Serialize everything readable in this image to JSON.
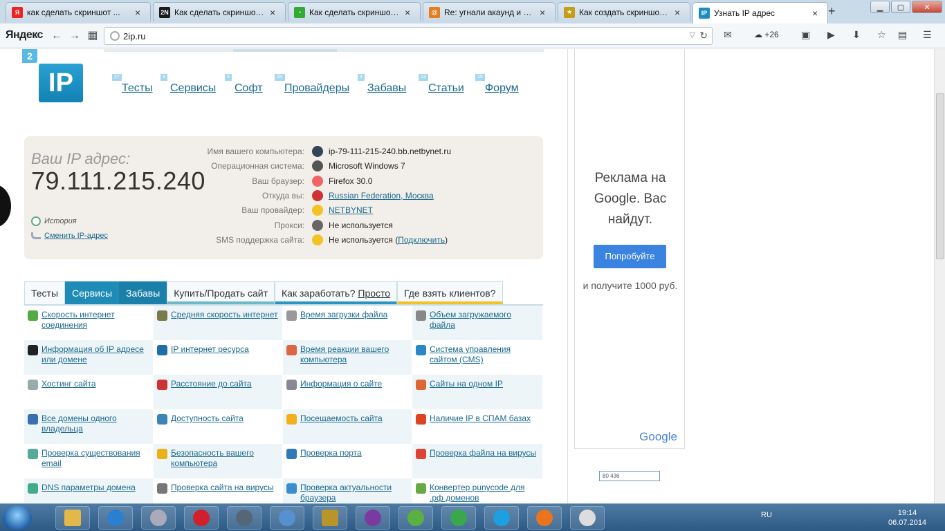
{
  "browser": {
    "tabs": [
      {
        "title": "как сделать скриншот ...",
        "favicon_color": "#e22",
        "favicon_text": "Я"
      },
      {
        "title": "Как сделать скриншот ...",
        "favicon_color": "#1a1a1a",
        "favicon_text": "2N"
      },
      {
        "title": "Как сделать скриншот ...",
        "favicon_color": "#3a3",
        "favicon_text": "◔"
      },
      {
        "title": "Re: угнали акаунд и по...",
        "favicon_color": "#e77c1c",
        "favicon_text": "@"
      },
      {
        "title": "Как создать скриншот ...",
        "favicon_color": "#c59d17",
        "favicon_text": "★"
      },
      {
        "title": "Узнать IP адрес",
        "favicon_color": "#1e8bc3",
        "favicon_text": "IP"
      }
    ],
    "new_tab": "+",
    "yandex_logo": "Яндекс",
    "url": "2ip.ru",
    "weather": "+26"
  },
  "site": {
    "logo_small": "2",
    "logo": "IP",
    "nav": [
      {
        "label": "Тесты",
        "badge": "27"
      },
      {
        "label": "Сервисы",
        "badge": "9"
      },
      {
        "label": "Софт",
        "badge": "5"
      },
      {
        "label": "Провайдеры",
        "badge": "2K"
      },
      {
        "label": "Забавы",
        "badge": "4"
      },
      {
        "label": "Статьи",
        "badge": "13"
      },
      {
        "label": "Форум",
        "badge": "15"
      }
    ],
    "ip_label": "Ваш IP адрес:",
    "ip_value": "79.111.215.240",
    "history": "История",
    "change_ip": "Сменить IP-адрес",
    "info": [
      {
        "label": "Имя вашего компьютера:",
        "value": "ip-79-111-215-240.bb.netbynet.ru",
        "link": false,
        "icon_color": "#345"
      },
      {
        "label": "Операционная система:",
        "value": "Microsoft Windows 7",
        "link": false,
        "icon_color": "#555"
      },
      {
        "label": "Ваш браузер:",
        "value": "Firefox 30.0",
        "link": false,
        "icon_color": "#e66"
      },
      {
        "label": "Откуда вы:",
        "value": "Russian Federation, Москва",
        "link": true,
        "icon_color": "#c33"
      },
      {
        "label": "Ваш провайдер:",
        "value": "NETBYNET",
        "link": true,
        "icon_color": "#f3c223"
      },
      {
        "label": "Прокси:",
        "value": "Не используется",
        "link": false,
        "icon_color": "#666"
      },
      {
        "label": "SMS поддержка сайта:",
        "value": "Не используется",
        "link": false,
        "icon_color": "#f3c223",
        "extra_link": "Подключить"
      }
    ],
    "tabs": [
      {
        "label": "Тесты"
      },
      {
        "label": "Сервисы"
      },
      {
        "label": "Забавы"
      },
      {
        "label": "Купить/Продать сайт"
      },
      {
        "label": "Как заработать?",
        "link": "Просто"
      },
      {
        "label": "Где взять клиентов?"
      }
    ],
    "services": [
      {
        "label": "Скорость интернет соединения",
        "icon_color": "#5a4"
      },
      {
        "label": "Средняя скорость интернет",
        "icon_color": "#7a7a4a"
      },
      {
        "label": "Время загрузки файла",
        "icon_color": "#999"
      },
      {
        "label": "Объем загружаемого файла",
        "icon_color": "#888"
      },
      {
        "label": "Информация об IP адресе или домене",
        "icon_color": "#222"
      },
      {
        "label": "IP интернет ресурса",
        "icon_color": "#1e6fa8"
      },
      {
        "label": "Время реакции вашего компьютера",
        "icon_color": "#d64"
      },
      {
        "label": "Система управления сайтом (CMS)",
        "icon_color": "#2a86c6"
      },
      {
        "label": "Хостинг сайта",
        "icon_color": "#9aa"
      },
      {
        "label": "Расстояние до сайта",
        "icon_color": "#c33"
      },
      {
        "label": "Информация о сайте",
        "icon_color": "#889"
      },
      {
        "label": "Сайты на одном IP",
        "icon_color": "#d63"
      },
      {
        "label": "Все домены одного владельца",
        "icon_color": "#3a6fb0"
      },
      {
        "label": "Доступность сайта",
        "icon_color": "#3a86b6"
      },
      {
        "label": "Посещаемость сайта",
        "icon_color": "#f3b01c"
      },
      {
        "label": "Наличие IP в СПАМ базах",
        "icon_color": "#d42"
      },
      {
        "label": "Проверка существования email",
        "icon_color": "#5a9"
      },
      {
        "label": "Безопасность вашего компьютера",
        "icon_color": "#e9b21a"
      },
      {
        "label": "Проверка порта",
        "icon_color": "#2f7ab6"
      },
      {
        "label": "Проверка файла на вирусы",
        "icon_color": "#d43"
      },
      {
        "label": "DNS параметры домена",
        "icon_color": "#4a8"
      },
      {
        "label": "Проверка сайта на вирусы",
        "icon_color": "#777"
      },
      {
        "label": "Проверка актуальности браузера",
        "icon_color": "#3a8ed0"
      },
      {
        "label": "Конвертер punycode для .рф доменов",
        "icon_color": "#6a4"
      }
    ]
  },
  "ad": {
    "text": "Реклама на Google. Вас найдут.",
    "button": "Попробуйте",
    "sub": "и получите 1000 руб.",
    "google": "Google",
    "counter": "80 436"
  },
  "taskbar": {
    "lang": "RU",
    "time": "19:14",
    "date": "06.07.2014"
  }
}
